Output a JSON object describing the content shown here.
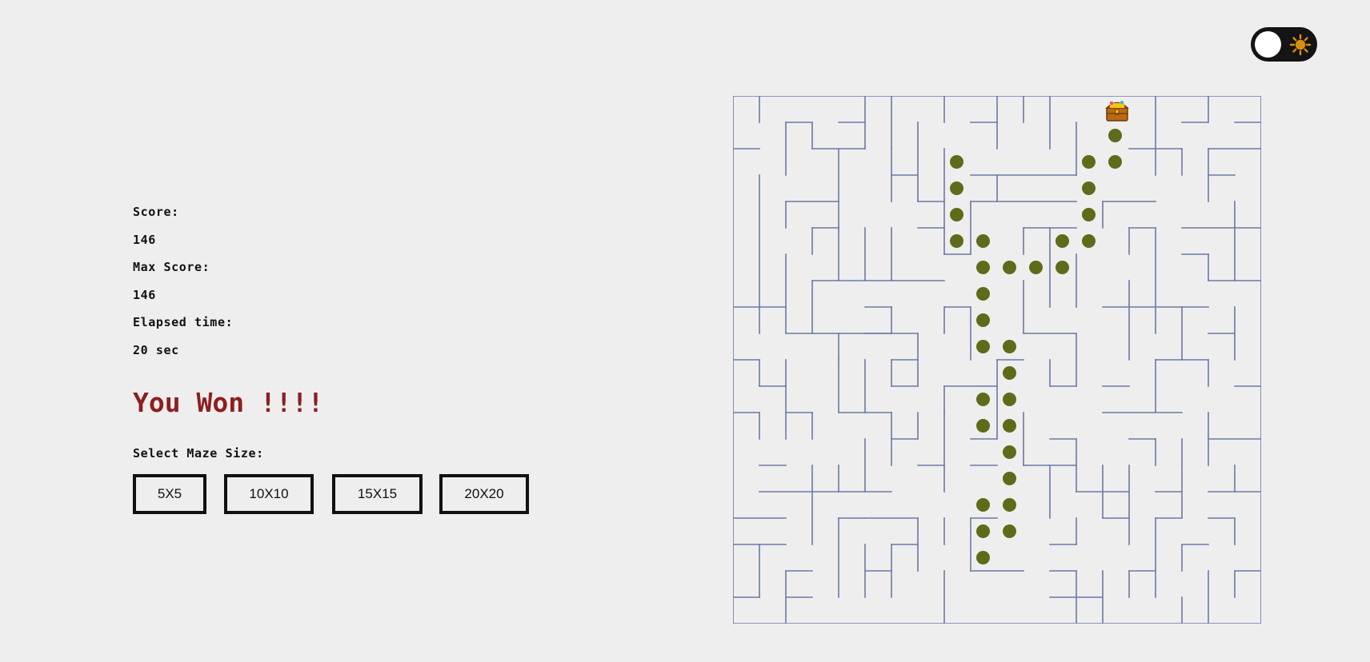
{
  "theme_toggle": {
    "icon": "sun-icon",
    "state": "light"
  },
  "stats": {
    "score_label": "Score:",
    "score_value": "146",
    "max_score_label": "Max Score:",
    "max_score_value": "146",
    "elapsed_label": "Elapsed time:",
    "elapsed_value": "20 sec"
  },
  "status_message": "You Won !!!!",
  "maze_size": {
    "label": "Select Maze Size:",
    "options": [
      "5X5",
      "10X10",
      "15X15",
      "20X20"
    ]
  },
  "maze": {
    "grid": "20X20",
    "goal_icon": "treasure-chest-icon",
    "wall_color": "#6b78a6",
    "trail_color": "#5e6b1a"
  }
}
